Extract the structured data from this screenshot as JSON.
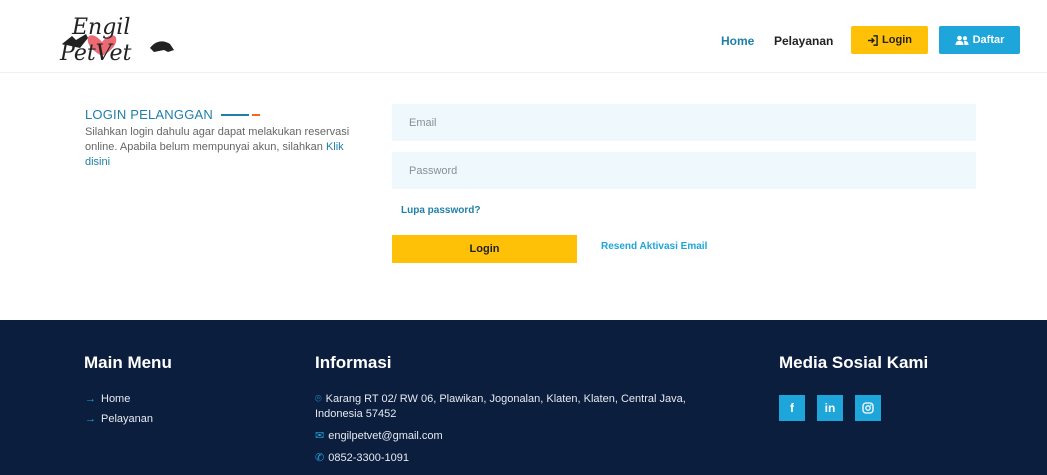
{
  "header": {
    "logo_text_top": "Engil",
    "logo_text_bottom": "PetVet",
    "nav": {
      "home": "Home",
      "pelayanan": "Pelayanan"
    },
    "login_label": "Login",
    "daftar_label": "Daftar"
  },
  "login": {
    "title": "LOGIN PELANGGAN",
    "desc": "Silahkan login dahulu agar dapat melakukan reservasi online. Apabila belum mempunyai akun, silahkan ",
    "desc_link": "Klik disini",
    "email_placeholder": "Email",
    "password_placeholder": "Password",
    "forgot": "Lupa password?",
    "submit": "Login",
    "resend": "Resend Aktivasi Email"
  },
  "footer": {
    "main_menu": {
      "title": "Main Menu",
      "items": [
        "Home",
        "Pelayanan"
      ]
    },
    "informasi": {
      "title": "Informasi",
      "address": "Karang RT 02/ RW 06, Plawikan, Jogonalan, Klaten, Klaten, Central Java, Indonesia 57452",
      "email": "engilpetvet@gmail.com",
      "phone": "0852-3300-1091"
    },
    "media": {
      "title": "Media Sosial Kami",
      "facebook": "f",
      "linkedin": "in"
    }
  },
  "colors": {
    "accent_blue": "#1ea5d9",
    "link_blue": "#1f7fa8",
    "yellow": "#ffc107",
    "footer_bg": "#0c1e3e",
    "orange": "#f26a21"
  }
}
